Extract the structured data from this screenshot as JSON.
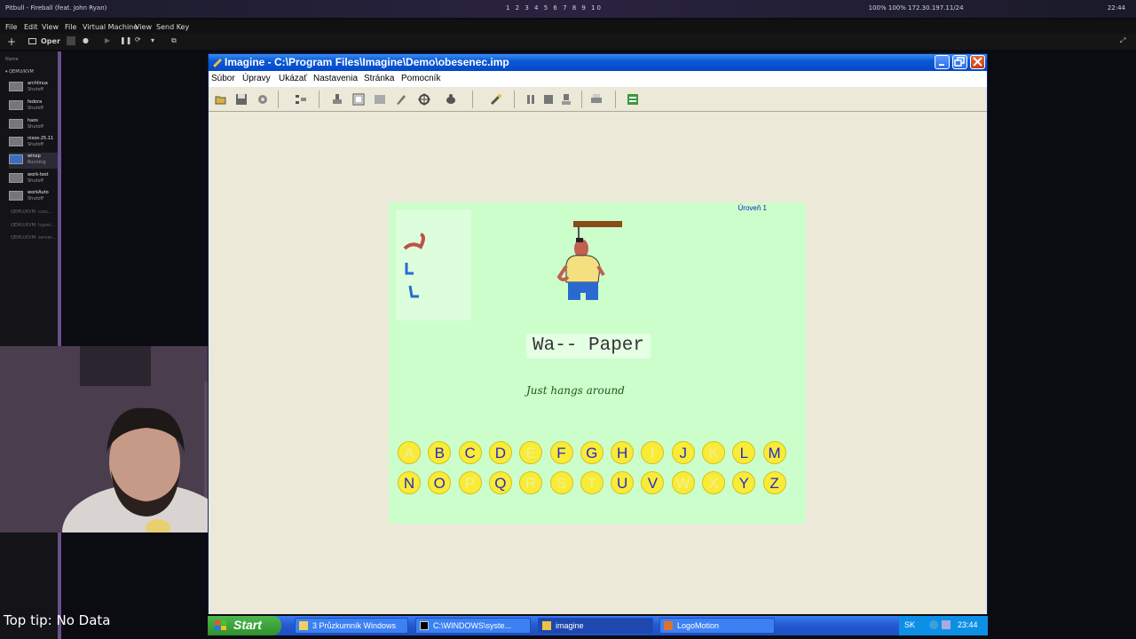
{
  "host": {
    "media_title": "Pitbull - Fireball (feat. John Ryan)",
    "workspaces": "1 2 3 4 5 6 7 8 9 10",
    "status": "100% 100% 172.30.197.11/24",
    "clock": "22:44"
  },
  "vm_manager": {
    "menu": [
      "File",
      "Edit",
      "View",
      "File",
      "Virtual Machine",
      "View",
      "Send Key"
    ],
    "open_label": "Oper",
    "name_label": "Name",
    "group_label": "QEMU/KVM",
    "vms": [
      {
        "name": "archlinux",
        "state": "Shutoff"
      },
      {
        "name": "fedora",
        "state": "Shutoff"
      },
      {
        "name": "haos",
        "state": "Shutoff"
      },
      {
        "name": "nixos-25.11",
        "state": "Shutoff"
      },
      {
        "name": "winxp",
        "state": "Running"
      },
      {
        "name": "work-test",
        "state": "Shutoff"
      },
      {
        "name": "workAuto",
        "state": "Shutoff"
      }
    ],
    "other_groups": [
      "QEMU/KVM: curs...",
      "QEMU/KVM: hyper...",
      "QEMU/KVM: server..."
    ]
  },
  "window": {
    "title": "Imagine - C:\\Program Files\\Imagine\\Demo\\obesenec.imp",
    "menu": [
      "Súbor",
      "Úpravy",
      "Ukázať",
      "Nastavenia",
      "Stránka",
      "Pomocník"
    ]
  },
  "toolbar": {
    "icons": [
      "open-icon",
      "save-icon",
      "settings-icon",
      "grid-icon",
      "stamp-icon",
      "frame-icon",
      "panel-icon",
      "pen-icon",
      "target-icon",
      "turtle-icon",
      "magic-icon",
      "pause-icon",
      "stop-icon",
      "step-icon",
      "print-icon",
      "page-icon"
    ]
  },
  "game": {
    "level": "Úroveň 1",
    "word": "Wa-- Paper",
    "hint": "Just hangs around",
    "letters_row1": [
      {
        "ch": "A",
        "used": true
      },
      {
        "ch": "B",
        "used": false
      },
      {
        "ch": "C",
        "used": false
      },
      {
        "ch": "D",
        "used": false
      },
      {
        "ch": "E",
        "used": true
      },
      {
        "ch": "F",
        "used": false
      },
      {
        "ch": "G",
        "used": false
      },
      {
        "ch": "H",
        "used": false
      },
      {
        "ch": "I",
        "used": true
      },
      {
        "ch": "J",
        "used": false
      },
      {
        "ch": "K",
        "used": true
      },
      {
        "ch": "L",
        "used": false
      },
      {
        "ch": "M",
        "used": false
      }
    ],
    "letters_row2": [
      {
        "ch": "N",
        "used": false
      },
      {
        "ch": "O",
        "used": false
      },
      {
        "ch": "P",
        "used": true
      },
      {
        "ch": "Q",
        "used": false
      },
      {
        "ch": "R",
        "used": true
      },
      {
        "ch": "S",
        "used": true
      },
      {
        "ch": "T",
        "used": true
      },
      {
        "ch": "U",
        "used": false
      },
      {
        "ch": "V",
        "used": false
      },
      {
        "ch": "W",
        "used": true
      },
      {
        "ch": "X",
        "used": true
      },
      {
        "ch": "Y",
        "used": false
      },
      {
        "ch": "Z",
        "used": false
      }
    ]
  },
  "taskbar": {
    "start_label": "Start",
    "tasks": [
      "3 Průzkumník Windows",
      "C:\\WINDOWS\\syste...",
      "imagine",
      "LogoMotion"
    ],
    "lang": "SK",
    "clock": "23:44"
  },
  "overlay": {
    "tip": "Top tip: No Data"
  },
  "colors": {
    "game_bg": "#ccfecc",
    "letter_fill": "#f8ec36",
    "letter_text": "#2828c8",
    "xp_title": "#0a5ad8"
  }
}
